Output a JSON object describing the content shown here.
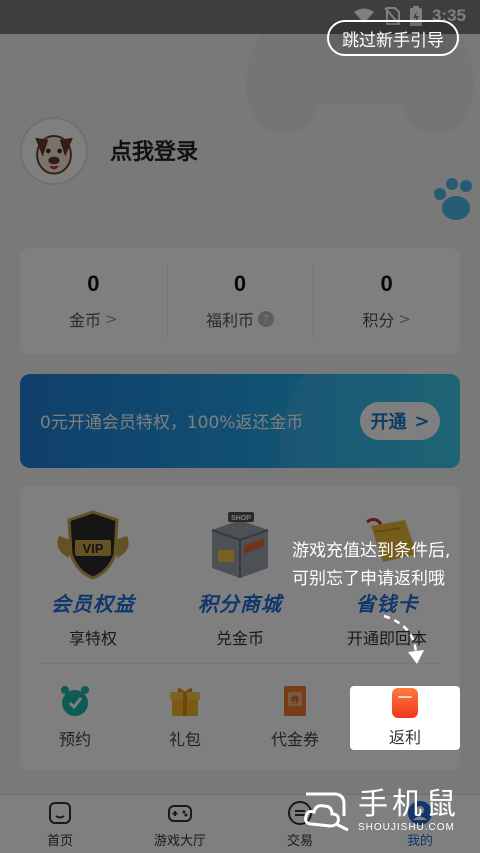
{
  "status_bar": {
    "time": "3:35"
  },
  "guide": {
    "skip_label": "跳过新手引导",
    "tip_line1": "游戏充值达到条件后,",
    "tip_line2": "可别忘了申请返利哦"
  },
  "profile": {
    "login_text": "点我登录"
  },
  "stats": [
    {
      "value": "0",
      "label": "金币",
      "suffix": "chevron"
    },
    {
      "value": "0",
      "label": "福利币",
      "suffix": "question"
    },
    {
      "value": "0",
      "label": "积分",
      "suffix": "chevron"
    }
  ],
  "vip_banner": {
    "text": "0元开通会员特权，100%返还金币",
    "button_label": "开通"
  },
  "features": [
    {
      "title": "会员权益",
      "subtitle": "享特权",
      "icon": "vip-badge-icon"
    },
    {
      "title": "积分商城",
      "subtitle": "兑金币",
      "icon": "shop-icon"
    },
    {
      "title": "省钱卡",
      "subtitle": "开通即回本",
      "icon": "money-card-icon"
    }
  ],
  "grid": [
    {
      "label": "预约",
      "icon": "alarm-clock-icon"
    },
    {
      "label": "礼包",
      "icon": "gift-icon"
    },
    {
      "label": "代金券",
      "icon": "coupon-icon"
    },
    {
      "label": "返利",
      "icon": "rebate-icon"
    }
  ],
  "bottom_nav": [
    {
      "label": "首页",
      "icon": "home-icon"
    },
    {
      "label": "游戏大厅",
      "icon": "gamepad-icon"
    },
    {
      "label": "交易",
      "icon": "trade-icon"
    },
    {
      "label": "我的",
      "icon": "profile-icon",
      "active": true
    }
  ],
  "watermark": {
    "brand": "手机鼠",
    "url": "SHOUJISHU.COM"
  },
  "colors": {
    "accent": "#1e6fd9",
    "banner_start": "#1f7fd6",
    "banner_end": "#2cc4ea",
    "rebate_red": "#f2361f"
  }
}
